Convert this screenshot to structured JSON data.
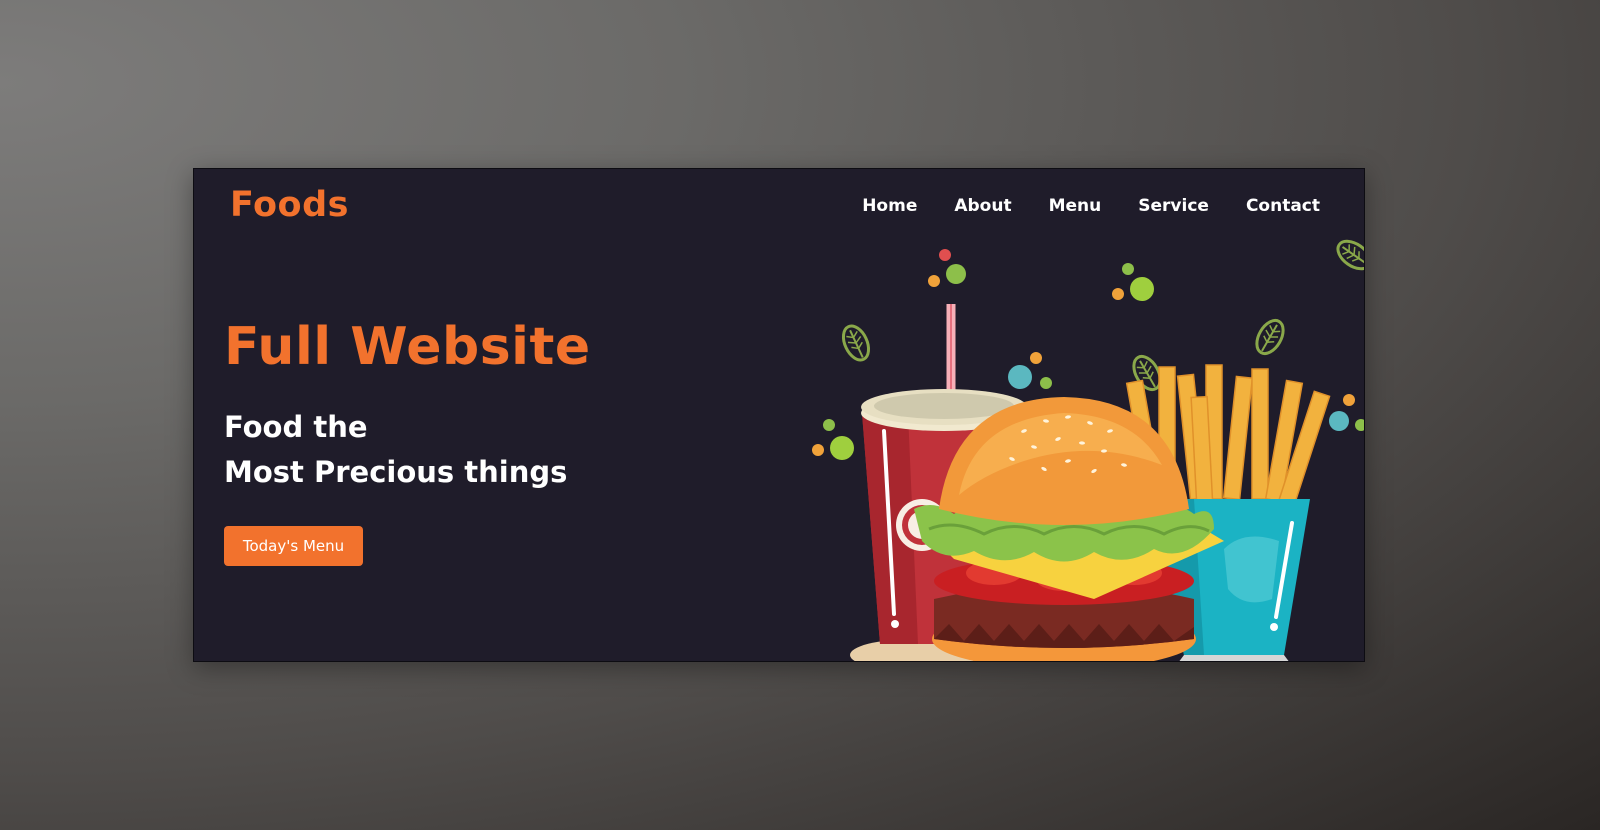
{
  "header": {
    "logo": "Foods",
    "nav": [
      "Home",
      "About",
      "Menu",
      "Service",
      "Contact"
    ]
  },
  "hero": {
    "title": "Full Website",
    "subtitle_line1": "Food the",
    "subtitle_line2": "Most Precious things",
    "cta_label": "Today's Menu"
  },
  "illustration": {
    "items": [
      "soda-cup-icon",
      "burger-icon",
      "fries-icon",
      "leaf-icon"
    ]
  },
  "colors": {
    "background": "#1f1c2a",
    "accent": "#f2722d",
    "text": "#ffffff"
  }
}
